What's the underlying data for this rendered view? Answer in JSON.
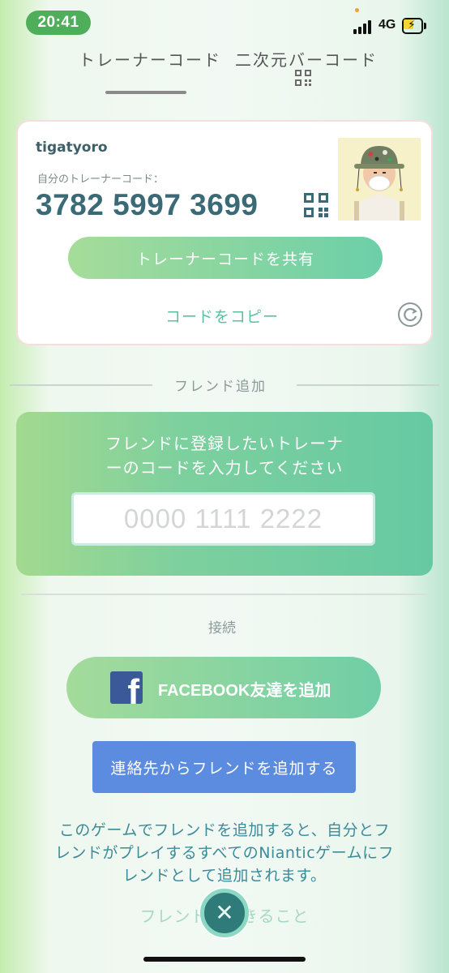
{
  "status_bar": {
    "time": "20:41",
    "network": "4G",
    "signal_bars": 4,
    "battery_level_fraction": 0.5,
    "time_pill_color": "#4fae5a"
  },
  "tabs": {
    "trainer_code": "トレーナーコード",
    "qr_code": "二次元バーコード",
    "active": "trainer_code",
    "qr_icon": "qr-code-icon"
  },
  "profile": {
    "username": "tigatyoro",
    "code_label": "自分のトレーナーコード：",
    "trainer_code": "3782 5997 3699",
    "qr_icon": "qr-code-icon",
    "avatar": "trainer-avatar"
  },
  "actions": {
    "share_label": "トレーナーコードを共有",
    "copy_label": "コードをコピー",
    "refresh_icon": "refresh-icon"
  },
  "friend_add": {
    "title": "フレンド追加",
    "instruction_line1": "フレンドに登録したいトレーナ",
    "instruction_line2": "ーのコードを入力してください",
    "input_placeholder": "0000 1111 2222",
    "input_value": ""
  },
  "connect": {
    "title": "接続",
    "facebook_label": "FACEBOOK友達を追加",
    "facebook_icon": "facebook-icon",
    "contacts_label": "連絡先からフレンドを追加する"
  },
  "info": {
    "line1": "このゲームでフレンドを追加すると、自分とフ",
    "line2": "レンドがプレイするすべてのNianticゲームにフ",
    "line3": "レンドとして追加されます。"
  },
  "bottom_link": "フレンドとできること",
  "close_icon": "close-icon",
  "colors": {
    "accent_green": "#6ccfa8",
    "contacts_blue": "#5c8ce0",
    "code_text": "#3a6a76",
    "close_button": "#2e7b7a"
  }
}
